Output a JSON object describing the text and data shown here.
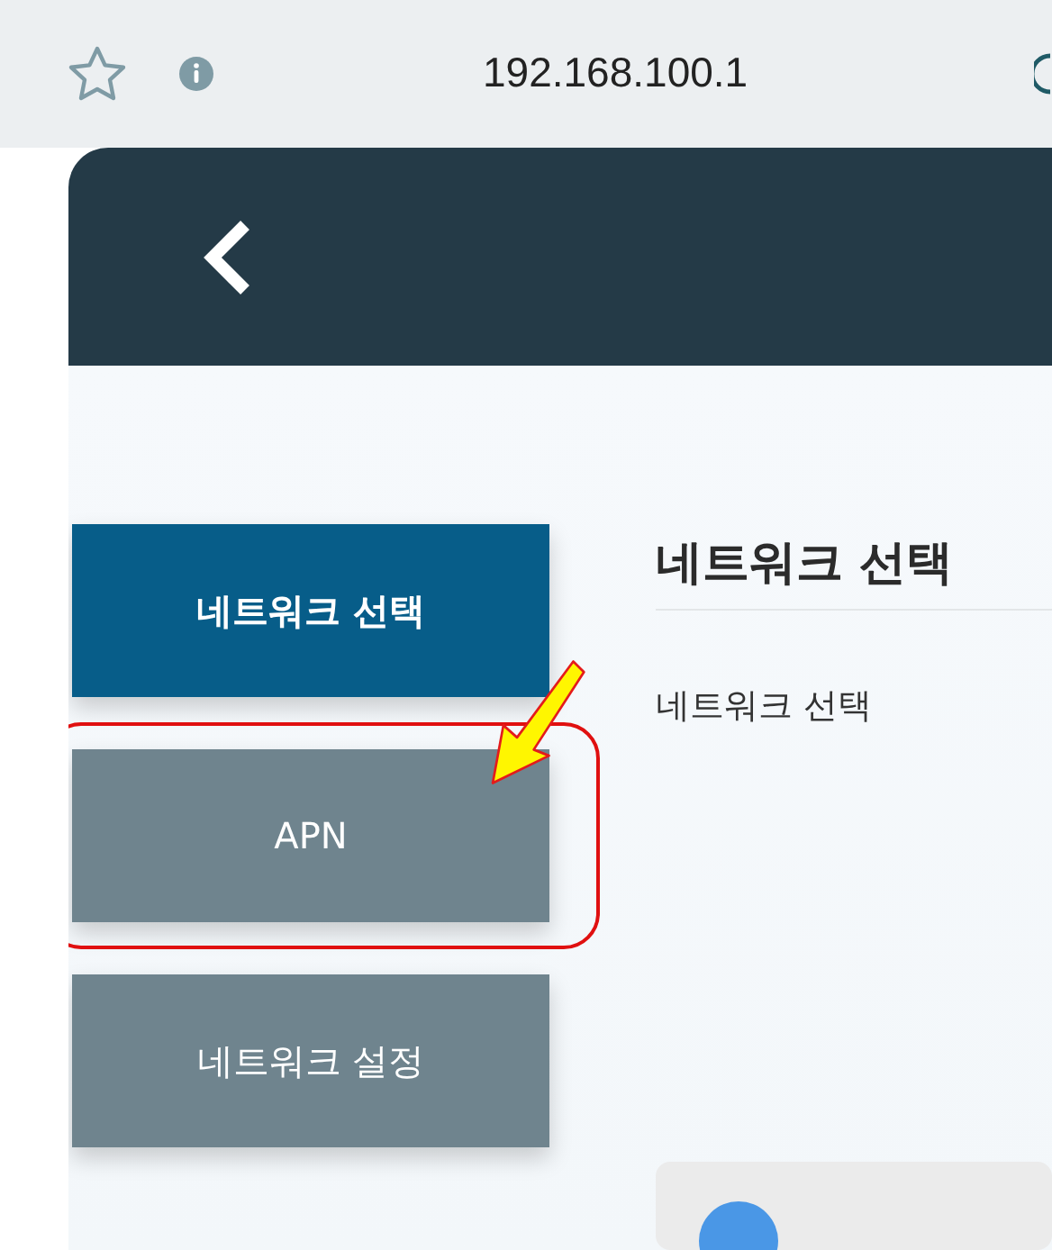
{
  "browser_bar": {
    "address": "192.168.100.1"
  },
  "menu": [
    {
      "label": "네트워크 선택",
      "selected": true
    },
    {
      "label": "APN",
      "selected": false
    },
    {
      "label": "네트워크 설정",
      "selected": false
    }
  ],
  "content": {
    "title": "네트워크 선택",
    "text": "네트워크 선택"
  }
}
